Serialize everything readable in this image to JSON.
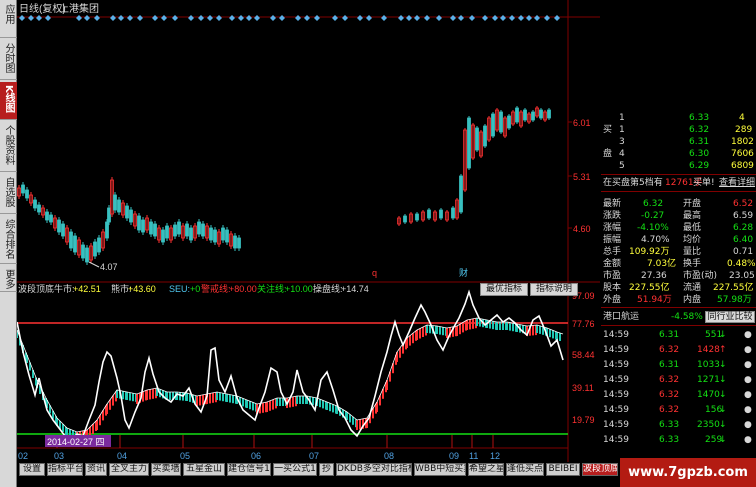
{
  "sidebar": {
    "tabs": [
      {
        "label": "应用",
        "active": false
      },
      {
        "label": "分时图",
        "active": false
      },
      {
        "label": "K线图",
        "active": true
      },
      {
        "label": "个股资料",
        "active": false
      },
      {
        "label": "自选股",
        "active": false
      },
      {
        "label": "综合排名",
        "active": false
      },
      {
        "label": "更多",
        "active": false
      }
    ]
  },
  "main_chart": {
    "title": "日线(复权)",
    "stock_name": "上港集团",
    "price_labels": [
      "6.01",
      "5.31",
      "4.60"
    ],
    "low_marker": "4.07",
    "markers": [
      "q",
      "财"
    ]
  },
  "indicator": {
    "name": "波段顶底",
    "items": [
      {
        "label": "牛市:",
        "value": "+42.51"
      },
      {
        "label": "熊市:",
        "value": "+43.60"
      },
      {
        "label": "SEU:",
        "value": "+0"
      },
      {
        "label": "警戒线:",
        "value": "+80.00"
      },
      {
        "label": "关注线:",
        "value": "+10.00"
      },
      {
        "label": "操盘线:",
        "value": "+14.74"
      }
    ],
    "buttons": [
      "最优指标",
      "指标说明"
    ],
    "levels": [
      "97.09",
      "77.76",
      "58.44",
      "39.11",
      "19.79"
    ],
    "date_label": "2014-02-27 四"
  },
  "x_axis_months": [
    "02",
    "03",
    "04",
    "05",
    "06",
    "07",
    "08",
    "09",
    "11",
    "12"
  ],
  "quote": {
    "ask_title": "买",
    "bid_title": "盘",
    "orders": [
      {
        "level": "1",
        "price": "6.33",
        "volume": "4"
      },
      {
        "level": "1",
        "price": "6.32",
        "volume": "289"
      },
      {
        "level": "3",
        "price": "6.31",
        "volume": "1802"
      },
      {
        "level": "4",
        "price": "6.30",
        "volume": "7606"
      },
      {
        "level": "5",
        "price": "6.29",
        "volume": "6809"
      }
    ],
    "bid_notice": {
      "prefix": "在买盘第5档有",
      "count": "12761手",
      "suffix": "买单!",
      "link": "查看详细"
    },
    "stats": [
      {
        "l1": "最新",
        "v1": "6.32",
        "l2": "开盘",
        "v2": "6.52"
      },
      {
        "l1": "涨跌",
        "v1": "-0.27",
        "l2": "最高",
        "v2": "6.59"
      },
      {
        "l1": "涨幅",
        "v1": "-4.10%",
        "l2": "最低",
        "v2": "6.28"
      },
      {
        "l1": "振幅",
        "v1": "4.70%",
        "l2": "均价",
        "v2": "6.40"
      },
      {
        "l1": "总手",
        "v1": "109.92万",
        "l2": "量比",
        "v2": "0.71"
      },
      {
        "l1": "金额",
        "v1": "7.03亿",
        "l2": "换手",
        "v2": "0.48%"
      },
      {
        "l1": "市盈",
        "v1": "27.36",
        "l2": "市盈(动)",
        "v2": "23.05"
      },
      {
        "l1": "股本",
        "v1": "227.55亿",
        "l2": "流通",
        "v2": "227.55亿"
      },
      {
        "l1": "外盘",
        "v1": "51.94万",
        "l2": "内盘",
        "v2": "57.98万"
      }
    ],
    "sector": {
      "name": "港口航运",
      "change": "-4.58%",
      "compare_button": "同行业比较"
    },
    "ticks": [
      {
        "time": "14:59",
        "price": "6.31",
        "volume": "551",
        "dir": "down"
      },
      {
        "time": "14:59",
        "price": "6.32",
        "volume": "1428",
        "dir": "up"
      },
      {
        "time": "14:59",
        "price": "6.31",
        "volume": "1033",
        "dir": "down"
      },
      {
        "time": "14:59",
        "price": "6.32",
        "volume": "1271",
        "dir": "down"
      },
      {
        "time": "14:59",
        "price": "6.32",
        "volume": "1470",
        "dir": "down"
      },
      {
        "time": "14:59",
        "price": "6.32",
        "volume": "156",
        "dir": "down"
      },
      {
        "time": "14:59",
        "price": "6.33",
        "volume": "2350",
        "dir": "down"
      },
      {
        "time": "14:59",
        "price": "6.33",
        "volume": "259",
        "dir": "down"
      }
    ]
  },
  "bottom_tabs": [
    "设置",
    "指标平台",
    "资讯",
    "全叉主力",
    "买卖墙",
    "五星金山",
    "建仓信号1",
    "一买公式1",
    "抄",
    "DKDB多空对比指标",
    "WBB中短买卖",
    "希望之星",
    "逢低买点",
    "BEIBEI",
    "波段顶底"
  ],
  "watermark": "www.7gpzb.com",
  "colors": {
    "up": "#ff3232",
    "down": "#14e014",
    "accent": "#b71e1e",
    "cyan": "#50c8f0",
    "yellow": "#ffff3c"
  }
}
